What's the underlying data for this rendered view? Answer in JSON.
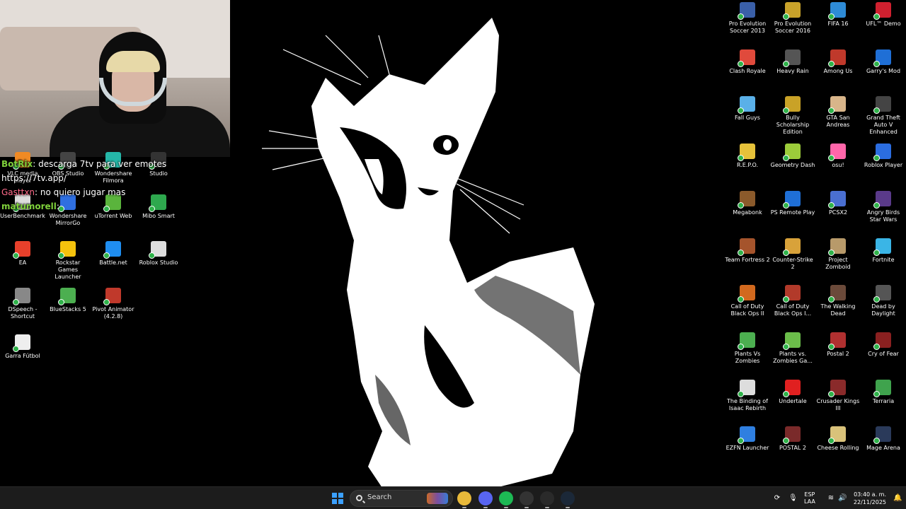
{
  "chat": [
    {
      "user": "BotRix",
      "text": ": descarga 7tv para ver emotes"
    },
    {
      "user": "",
      "text": "https://7tv.app/"
    },
    {
      "user": "Gasttxn",
      "text": ": no quiero jugar mas"
    },
    {
      "user": "matumorell",
      "text": ":"
    }
  ],
  "left_icons": [
    {
      "label": "VLC media player",
      "color": "#f08a24"
    },
    {
      "label": "OBS Studio",
      "color": "#444"
    },
    {
      "label": "Wondershare Filmora",
      "color": "#25b7a8"
    },
    {
      "label": "Studio",
      "color": "#333"
    },
    {
      "label": "UserBenchmark",
      "color": "#ddd"
    },
    {
      "label": "Wondershare MirrorGo",
      "color": "#2f6fe0"
    },
    {
      "label": "uTorrent Web",
      "color": "#5ab43c"
    },
    {
      "label": "Mibo Smart",
      "color": "#2ea84e"
    },
    {
      "label": "EA",
      "color": "#e8402b"
    },
    {
      "label": "Rockstar Games Launcher",
      "color": "#f4c20d"
    },
    {
      "label": "Battle.net",
      "color": "#1f8ef1"
    },
    {
      "label": "Roblox Studio",
      "color": "#ddd"
    },
    {
      "label": "DSpeech - Shortcut",
      "color": "#888"
    },
    {
      "label": "BlueStacks 5",
      "color": "#4caf50"
    },
    {
      "label": "Pivot Animator (4.2.8)",
      "color": "#c0392b"
    },
    {
      "label": "Garra Fútbol",
      "color": "#eee"
    }
  ],
  "right_icons": [
    {
      "label": "Pro Evolution Soccer 2013",
      "color": "#3a5fa8"
    },
    {
      "label": "Pro Evolution Soccer 2016",
      "color": "#c8a22a"
    },
    {
      "label": "FIFA 16",
      "color": "#2e8bd6"
    },
    {
      "label": "UFL™ Demo",
      "color": "#d0202f"
    },
    {
      "label": "Clash Royale",
      "color": "#e04a3c"
    },
    {
      "label": "Heavy Rain",
      "color": "#555"
    },
    {
      "label": "Among Us",
      "color": "#c0392b"
    },
    {
      "label": "Garry's Mod",
      "color": "#1f6fd6"
    },
    {
      "label": "Fall Guys",
      "color": "#5ab0e8"
    },
    {
      "label": "Bully Scholarship Edition",
      "color": "#c9a227"
    },
    {
      "label": "GTA San Andreas",
      "color": "#d8b58a"
    },
    {
      "label": "Grand Theft Auto V Enhanced",
      "color": "#444"
    },
    {
      "label": "R.E.P.O.",
      "color": "#e6c23a"
    },
    {
      "label": "Geometry Dash",
      "color": "#9ccc3a"
    },
    {
      "label": "osu!",
      "color": "#ff66aa"
    },
    {
      "label": "Roblox Player",
      "color": "#2b6de0"
    },
    {
      "label": "Megabonk",
      "color": "#8b5a2b"
    },
    {
      "label": "PS Remote Play",
      "color": "#1f6fd6"
    },
    {
      "label": "PCSX2",
      "color": "#4a6fd1"
    },
    {
      "label": "Angry Birds Star Wars",
      "color": "#5a3a8a"
    },
    {
      "label": "Team Fortress 2",
      "color": "#a5542c"
    },
    {
      "label": "Counter-Strike 2",
      "color": "#d8a23a"
    },
    {
      "label": "Project Zomboid",
      "color": "#b89a6a"
    },
    {
      "label": "Fortnite",
      "color": "#3ab5e6"
    },
    {
      "label": "Call of Duty Black Ops II",
      "color": "#d2691e"
    },
    {
      "label": "Call of Duty Black Ops I...",
      "color": "#b23a2a"
    },
    {
      "label": "The Walking Dead",
      "color": "#6b4a3a"
    },
    {
      "label": "Dead by Daylight",
      "color": "#555"
    },
    {
      "label": "Plants Vs Zombies",
      "color": "#4caf50"
    },
    {
      "label": "Plants vs. Zombies Ga...",
      "color": "#6bbd4a"
    },
    {
      "label": "Postal 2",
      "color": "#b03030"
    },
    {
      "label": "Cry of Fear",
      "color": "#8a2020"
    },
    {
      "label": "The Binding of Isaac Rebirth",
      "color": "#ddd"
    },
    {
      "label": "Undertale",
      "color": "#e02020"
    },
    {
      "label": "Crusader Kings III",
      "color": "#8a2a2a"
    },
    {
      "label": "Terraria",
      "color": "#3fa34d"
    },
    {
      "label": "EZFN Launcher",
      "color": "#2f7fe0"
    },
    {
      "label": "POSTAL 2",
      "color": "#7a2a2a"
    },
    {
      "label": "Cheese Rolling",
      "color": "#d9c27a"
    },
    {
      "label": "Mage Arena",
      "color": "#2a3a5a"
    }
  ],
  "taskbar": {
    "search_label": "Search",
    "apps": [
      {
        "name": "chrome",
        "color": "#e8b93a"
      },
      {
        "name": "discord",
        "color": "#5865f2"
      },
      {
        "name": "spotify",
        "color": "#1db954"
      },
      {
        "name": "obs",
        "color": "#333"
      },
      {
        "name": "epic-games",
        "color": "#2a2a2a"
      },
      {
        "name": "steam",
        "color": "#1b2838"
      }
    ],
    "lang_line1": "ESP",
    "lang_line2": "LAA",
    "time": "03:40 a. m.",
    "date": "22/11/2025"
  }
}
